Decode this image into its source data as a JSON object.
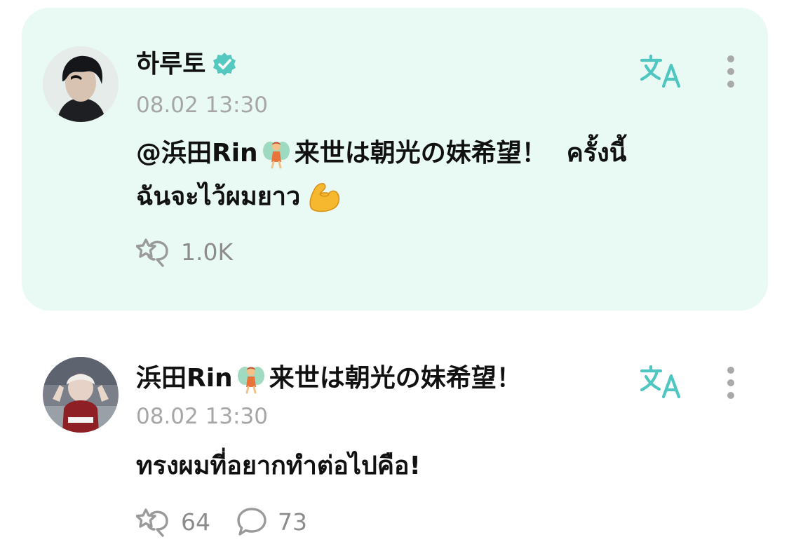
{
  "posts": [
    {
      "author": "하루토",
      "verified": true,
      "timestamp": "08.02 13:30",
      "body_line1_mention": "@浜田Rin",
      "body_line1_mention_rest": "来世は朝光の妹希望！",
      "body_line1_text": "ครั้งนี้",
      "body_line2_text": "ฉันจะไว้ผมยาว",
      "reactions_count": "1.0K",
      "icons": [
        "verified-badge-icon",
        "translate-icon",
        "more-options-icon",
        "reaction-icon",
        "muscle-emoji-icon",
        "fairy-emoji-icon"
      ]
    },
    {
      "author_part1": "浜田Rin",
      "author_part2": "来世は朝光の妹希望！",
      "timestamp": "08.02 13:30",
      "body_text": "ทรงผมที่อยากทำต่อไปคือ!",
      "reactions_count": "64",
      "comments_count": "73",
      "icons": [
        "translate-icon",
        "more-options-icon",
        "reaction-icon",
        "comment-icon",
        "fairy-emoji-icon"
      ]
    }
  ],
  "colors": {
    "highlight_bg": "#e9faf5",
    "accent": "#4fc6c2",
    "muted": "#a6a6a6",
    "verified": "#55c8bf"
  }
}
